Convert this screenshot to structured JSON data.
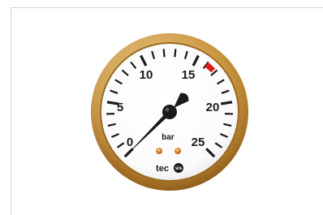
{
  "gauge": {
    "unit": "bar",
    "brand": "tec",
    "brand_badge": "sis",
    "scale_labels": [
      "0",
      "5",
      "10",
      "15",
      "20",
      "25"
    ],
    "scale_min": 0,
    "scale_max": 25,
    "needle_value": 0,
    "red_zone_from": 16,
    "red_zone_to": 16.8,
    "colors": {
      "bezel_gold": "#c9913a",
      "bezel_highlight": "#f3d28a",
      "dial_face": "#ffffff",
      "marks": "#1a1a1a",
      "red_zone": "#e01b1b",
      "screws": "#c9701a"
    }
  }
}
